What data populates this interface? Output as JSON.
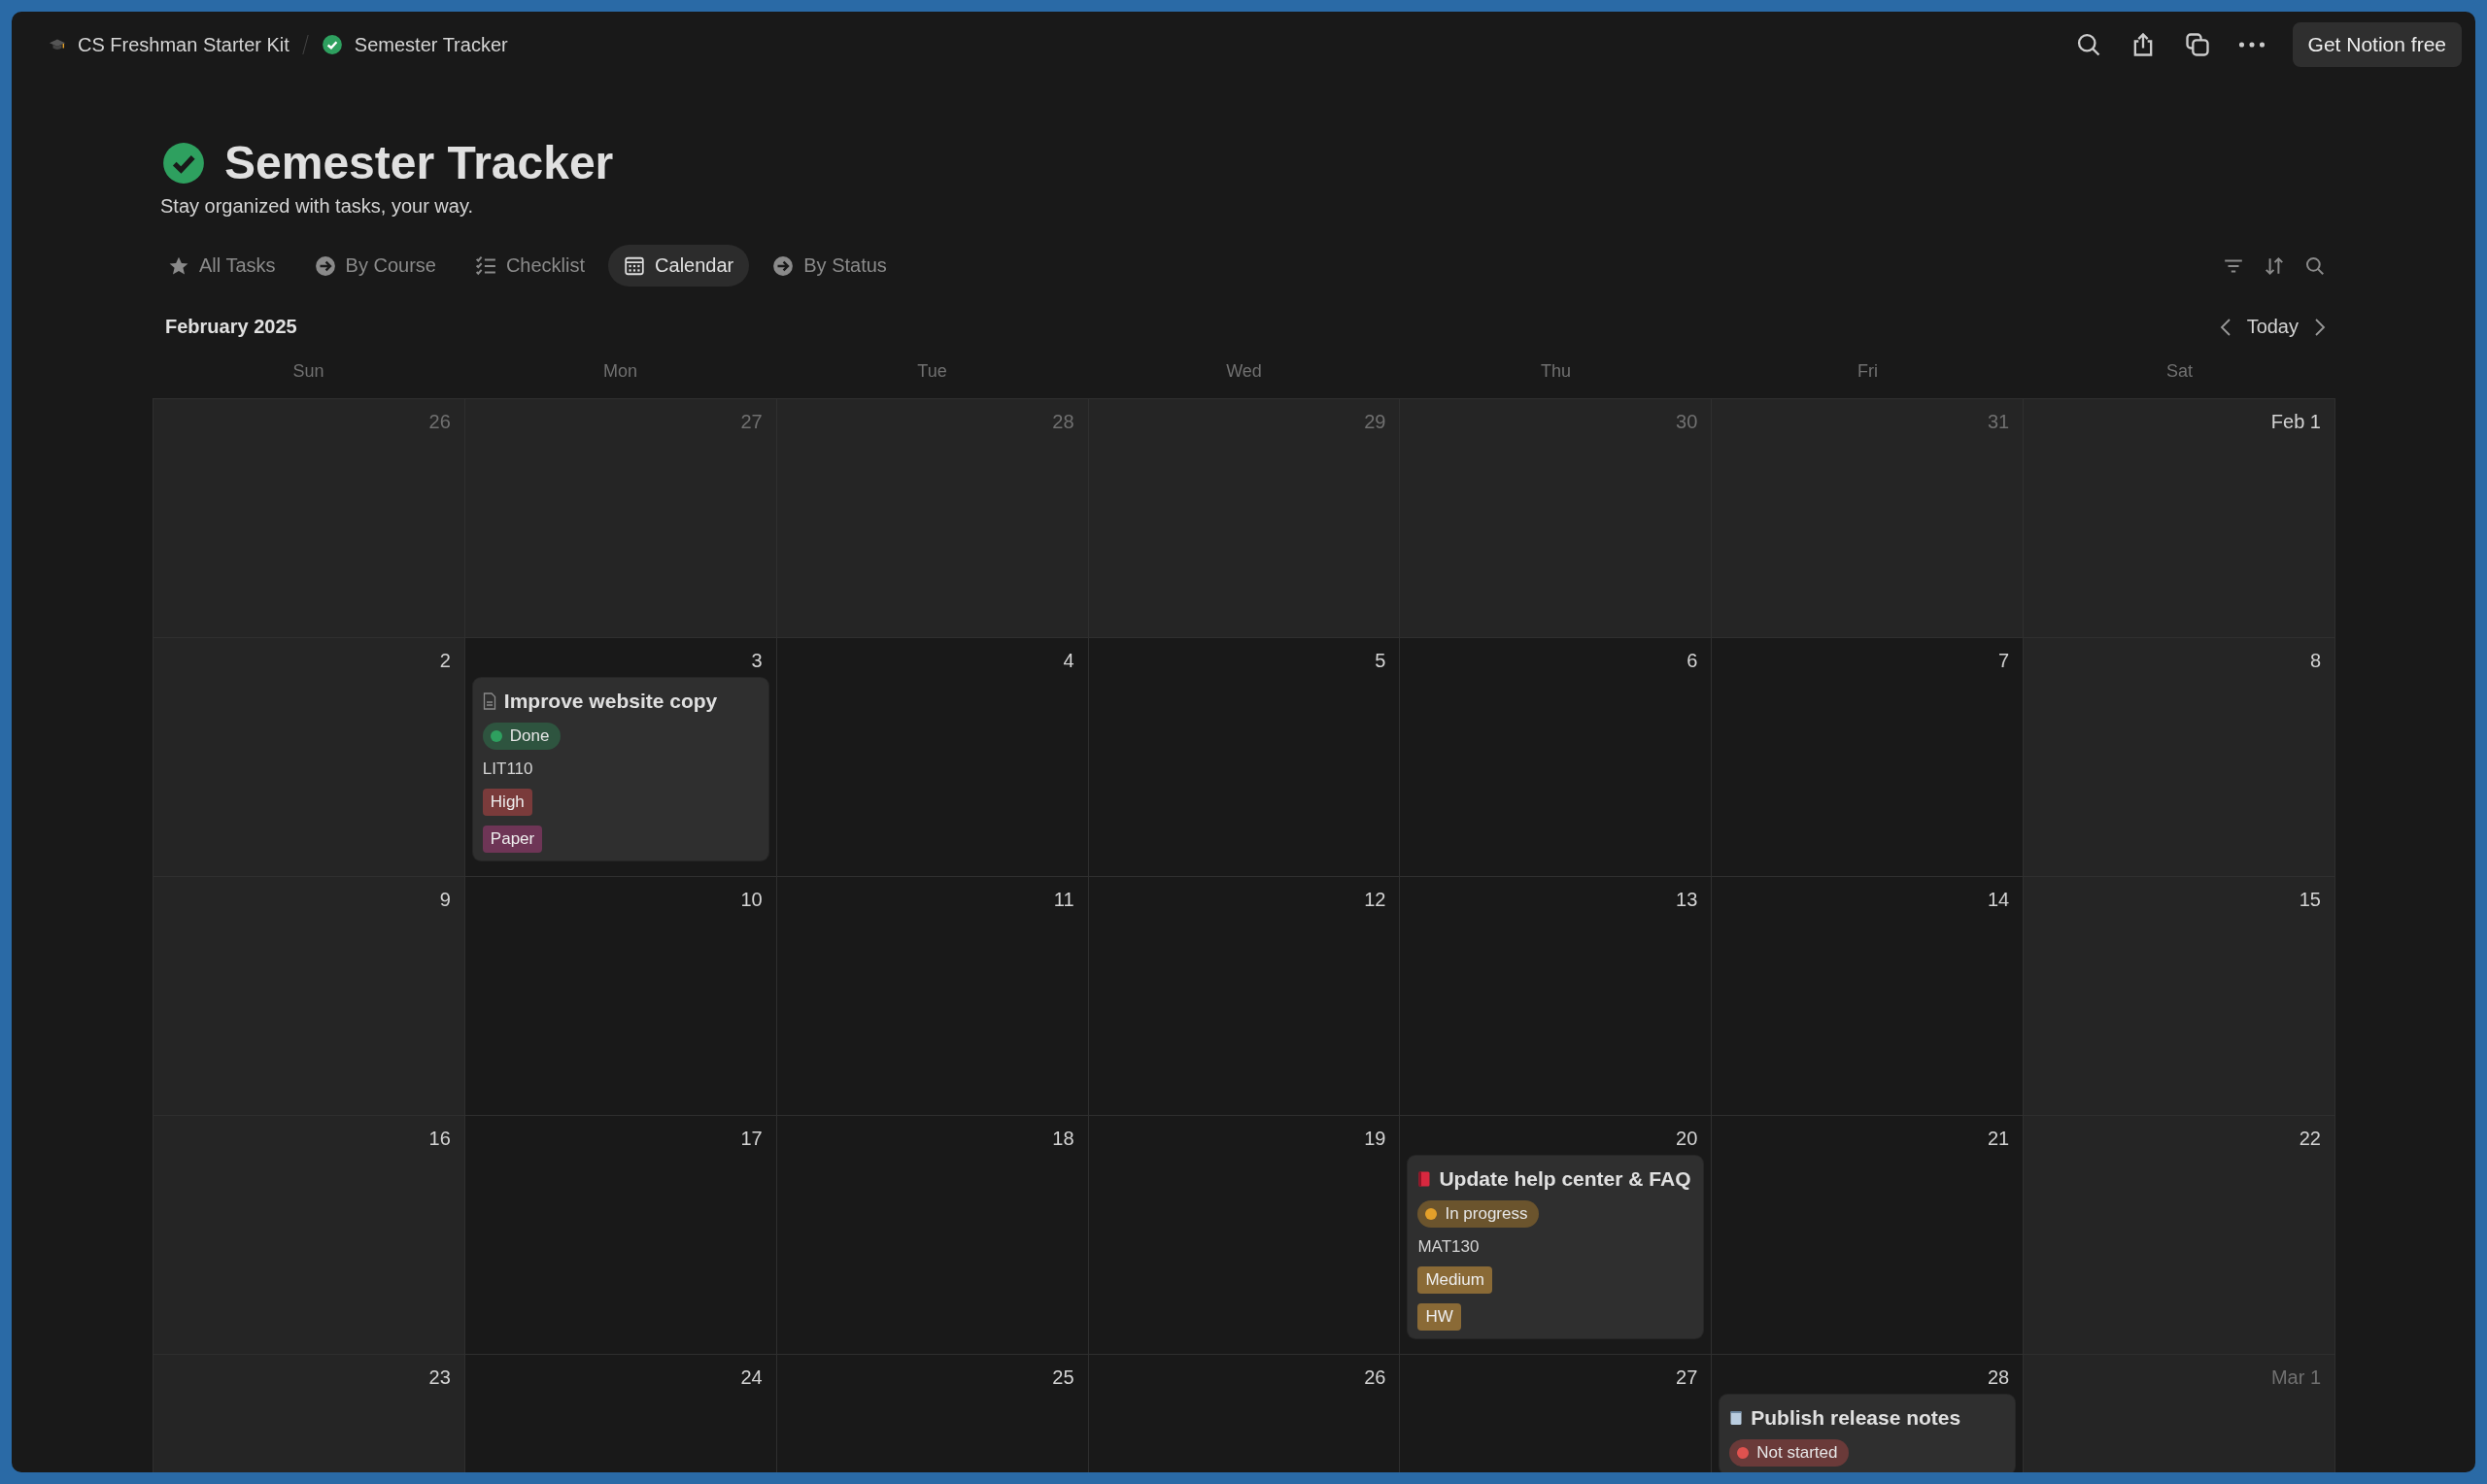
{
  "breadcrumb": {
    "workspace": "CS Freshman Starter Kit",
    "page": "Semester Tracker"
  },
  "top_button": "Get Notion free",
  "page": {
    "title": "Semester Tracker",
    "description": "Stay organized with tasks, your way."
  },
  "views": [
    {
      "label": "All Tasks",
      "kind": "star",
      "selected": false
    },
    {
      "label": "By Course",
      "kind": "arrow",
      "selected": false
    },
    {
      "label": "Checklist",
      "kind": "checklist",
      "selected": false
    },
    {
      "label": "Calendar",
      "kind": "calendar",
      "selected": true
    },
    {
      "label": "By Status",
      "kind": "arrow",
      "selected": false
    }
  ],
  "calendar": {
    "month": "February 2025",
    "today": "Today",
    "weekdays": [
      "Sun",
      "Mon",
      "Tue",
      "Wed",
      "Thu",
      "Fri",
      "Sat"
    ],
    "weeks": [
      [
        {
          "label": "26",
          "in_month": false,
          "shaded": true
        },
        {
          "label": "27",
          "in_month": false,
          "shaded": true
        },
        {
          "label": "28",
          "in_month": false,
          "shaded": true
        },
        {
          "label": "29",
          "in_month": false,
          "shaded": true
        },
        {
          "label": "30",
          "in_month": false,
          "shaded": true
        },
        {
          "label": "31",
          "in_month": false,
          "shaded": true
        },
        {
          "label": "Feb 1",
          "in_month": true,
          "shaded": true
        }
      ],
      [
        {
          "label": "2",
          "in_month": true,
          "shaded": true
        },
        {
          "label": "3",
          "in_month": true,
          "shaded": false,
          "events": [
            {
              "title": "Improve website copy",
              "kind": "page",
              "status": {
                "label": "Done",
                "color": "#2ea05f"
              },
              "course": "LIT110",
              "priority": {
                "label": "High",
                "color": "#7a3b3b"
              },
              "type": {
                "label": "Paper",
                "color": "#6e3556"
              }
            }
          ]
        },
        {
          "label": "4",
          "in_month": true,
          "shaded": false
        },
        {
          "label": "5",
          "in_month": true,
          "shaded": false
        },
        {
          "label": "6",
          "in_month": true,
          "shaded": false
        },
        {
          "label": "7",
          "in_month": true,
          "shaded": false
        },
        {
          "label": "8",
          "in_month": true,
          "shaded": true
        }
      ],
      [
        {
          "label": "9",
          "in_month": true,
          "shaded": true
        },
        {
          "label": "10",
          "in_month": true,
          "shaded": false
        },
        {
          "label": "11",
          "in_month": true,
          "shaded": false
        },
        {
          "label": "12",
          "in_month": true,
          "shaded": false
        },
        {
          "label": "13",
          "in_month": true,
          "shaded": false
        },
        {
          "label": "14",
          "in_month": true,
          "shaded": false
        },
        {
          "label": "15",
          "in_month": true,
          "shaded": true
        }
      ],
      [
        {
          "label": "16",
          "in_month": true,
          "shaded": true
        },
        {
          "label": "17",
          "in_month": true,
          "shaded": false
        },
        {
          "label": "18",
          "in_month": true,
          "shaded": false
        },
        {
          "label": "19",
          "in_month": true,
          "shaded": false
        },
        {
          "label": "20",
          "in_month": true,
          "shaded": false,
          "events": [
            {
              "title": "Update help center & FAQ",
              "kind": "book",
              "status": {
                "label": "In progress",
                "color": "#e3a02a"
              },
              "course": "MAT130",
              "priority": {
                "label": "Medium",
                "color": "#8a6a36"
              },
              "type": {
                "label": "HW",
                "color": "#8a6a36"
              }
            }
          ]
        },
        {
          "label": "21",
          "in_month": true,
          "shaded": false
        },
        {
          "label": "22",
          "in_month": true,
          "shaded": true
        }
      ],
      [
        {
          "label": "23",
          "in_month": true,
          "shaded": true
        },
        {
          "label": "24",
          "in_month": true,
          "shaded": false
        },
        {
          "label": "25",
          "in_month": true,
          "shaded": false
        },
        {
          "label": "26",
          "in_month": true,
          "shaded": false
        },
        {
          "label": "27",
          "in_month": true,
          "shaded": false
        },
        {
          "label": "28",
          "in_month": true,
          "shaded": false,
          "events": [
            {
              "title": "Publish release notes",
              "kind": "notepad",
              "status": {
                "label": "Not started",
                "color": "#e0524f"
              }
            }
          ]
        },
        {
          "label": "Mar 1",
          "in_month": false,
          "shaded": true
        }
      ]
    ]
  }
}
